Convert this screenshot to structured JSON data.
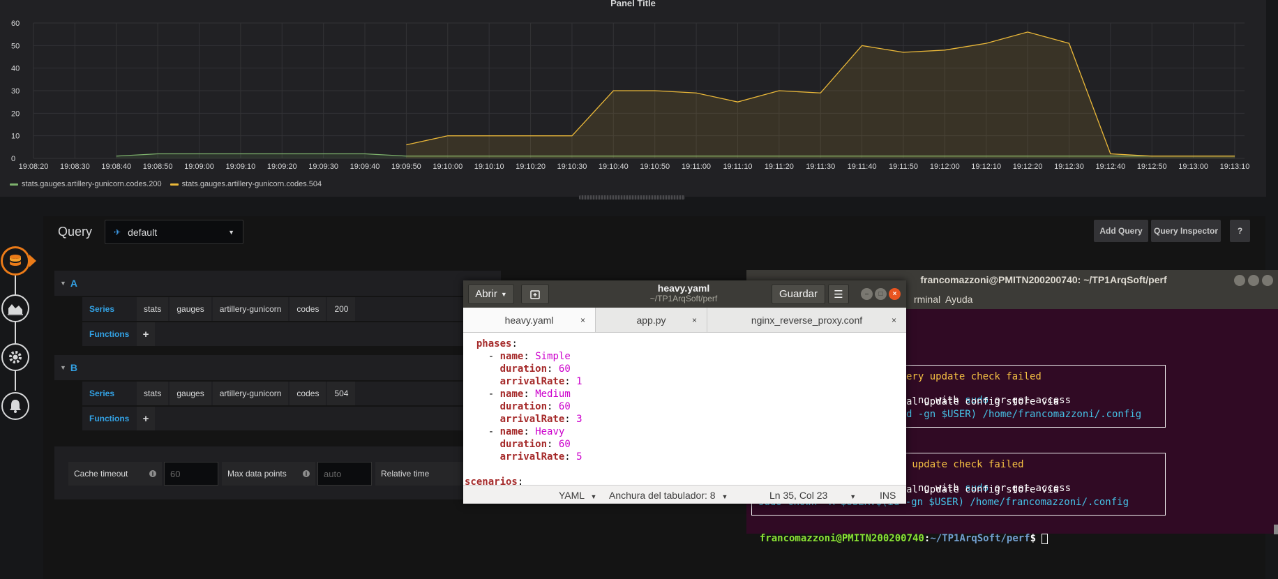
{
  "graph": {
    "title": "Panel Title",
    "legend": [
      {
        "name": "stats.gauges.artillery-gunicorn.codes.200",
        "color": "#7eb26d"
      },
      {
        "name": "stats.gauges.artillery-gunicorn.codes.504",
        "color": "#eab839"
      }
    ]
  },
  "chart_data": {
    "type": "area",
    "title": "Panel Title",
    "xlabel": "",
    "ylabel": "",
    "ylim": [
      0,
      60
    ],
    "yticks": [
      "0",
      "10",
      "20",
      "30",
      "40",
      "50",
      "60"
    ],
    "x": [
      "19:08:20",
      "19:08:30",
      "19:08:40",
      "19:08:50",
      "19:09:00",
      "19:09:10",
      "19:09:20",
      "19:09:30",
      "19:09:40",
      "19:09:50",
      "19:10:00",
      "19:10:10",
      "19:10:20",
      "19:10:30",
      "19:10:40",
      "19:10:50",
      "19:11:00",
      "19:11:10",
      "19:11:20",
      "19:11:30",
      "19:11:40",
      "19:11:50",
      "19:12:00",
      "19:12:10",
      "19:12:20",
      "19:12:30",
      "19:12:40",
      "19:12:50",
      "19:13:00",
      "19:13:10"
    ],
    "grid": true,
    "legend_position": "bottom-left",
    "series": [
      {
        "name": "stats.gauges.artillery-gunicorn.codes.200",
        "color": "#7eb26d",
        "values": [
          null,
          null,
          1,
          2,
          2,
          2,
          2,
          2,
          2,
          1,
          1,
          1,
          1,
          1,
          1,
          1,
          1,
          1,
          1,
          1,
          1,
          1,
          1,
          1,
          1,
          1,
          1,
          1,
          1,
          1
        ]
      },
      {
        "name": "stats.gauges.artillery-gunicorn.codes.504",
        "color": "#eab839",
        "values": [
          null,
          null,
          null,
          null,
          null,
          null,
          null,
          null,
          null,
          6,
          10,
          10,
          10,
          10,
          30,
          30,
          29,
          25,
          30,
          29,
          50,
          47,
          48,
          51,
          56,
          51,
          2,
          1,
          1,
          1
        ]
      }
    ]
  },
  "query": {
    "label": "Query",
    "datasource": "default",
    "add_query": "Add Query",
    "query_inspector": "Query Inspector",
    "help": "?",
    "queries": [
      {
        "letter": "A",
        "series_label": "Series",
        "segments": [
          "stats",
          "gauges",
          "artillery-gunicorn",
          "codes",
          "200"
        ],
        "functions_label": "Functions",
        "add": "+"
      },
      {
        "letter": "B",
        "series_label": "Series",
        "segments": [
          "stats",
          "gauges",
          "artillery-gunicorn",
          "codes",
          "504"
        ],
        "functions_label": "Functions",
        "add": "+"
      }
    ],
    "options": {
      "cache_timeout_label": "Cache timeout",
      "cache_timeout_placeholder": "60",
      "max_data_points_label": "Max data points",
      "max_data_points_placeholder": "auto",
      "relative_time_label": "Relative time"
    }
  },
  "terminal": {
    "title": "francomazzoni@PMITN200200740: ~/TP1ArqSoft/perf",
    "menu": [
      "rminal",
      "Ayuda"
    ],
    "box1": {
      "l1": "ery update check failed",
      "l2a": "ng with ",
      "l2b": "sudo",
      "l2c": " or get access",
      "l3": "al update config store via",
      "l4": "d -gn $USER) /home/francomazzoni/.config"
    },
    "box2": {
      "l1": " update check failed",
      "l2a": "ng with ",
      "l2b": "sudo",
      "l2c": " or get access",
      "l3": "al update config store via",
      "l4": "sudo chown -R $USER:$(id -gn $USER) /home/francomazzoni/.config"
    },
    "prompt_user": "francomazzoni@PMITN200200740",
    "prompt_sep": ":",
    "prompt_path": "~/TP1ArqSoft/perf",
    "prompt_end": "$ "
  },
  "gedit": {
    "open_label": "Abrir",
    "title": "heavy.yaml",
    "subtitle": "~/TP1ArqSoft/perf",
    "save_label": "Guardar",
    "tabs": [
      {
        "label": "heavy.yaml",
        "close": "×"
      },
      {
        "label": "app.py",
        "close": "×"
      },
      {
        "label": "nginx_reverse_proxy.conf",
        "close": "×"
      }
    ],
    "code": {
      "phases": "phases",
      "name": "name",
      "duration": "duration",
      "arrival": "arrivalRate",
      "p1_name": "Simple",
      "p1_dur": "60",
      "p1_rate": "1",
      "p2_name": "Medium",
      "p2_dur": "60",
      "p2_rate": "3",
      "p3_name": "Heavy",
      "p3_dur": "60",
      "p3_rate": "5",
      "scenarios": "scenarios"
    },
    "status": {
      "language": "YAML",
      "tab_width": "Anchura del tabulador: 8",
      "position": "Ln 35, Col 23",
      "mode": "INS"
    }
  }
}
